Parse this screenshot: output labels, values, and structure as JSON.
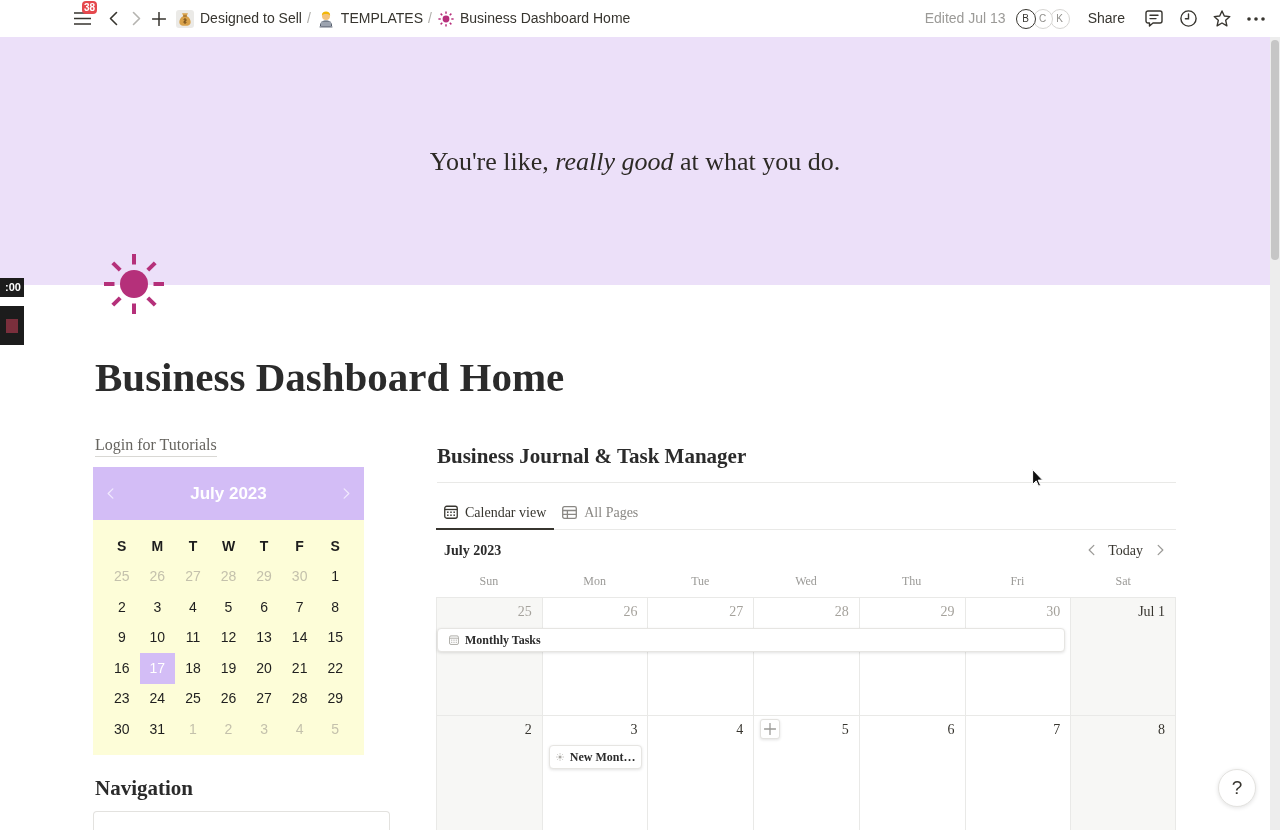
{
  "topbar": {
    "notification_count": "38",
    "nav_buttons": [
      {
        "kind": "back",
        "disabled": false
      },
      {
        "kind": "forward",
        "disabled": true
      },
      {
        "kind": "new",
        "disabled": false
      }
    ],
    "breadcrumbs": [
      {
        "label": "Designed to Sell",
        "separator": "/"
      },
      {
        "label": "TEMPLATES",
        "separator": "/"
      },
      {
        "label": "Business Dashboard Home"
      }
    ],
    "edited": "Edited Jul 13",
    "avatars": [
      {
        "initial": "B",
        "active": true
      },
      {
        "initial": "C",
        "active": false
      },
      {
        "initial": "K",
        "active": false
      }
    ],
    "share": "Share"
  },
  "recorder": {
    "timer": ":00"
  },
  "cover": {
    "quote": "You're like, *really good* at what you do."
  },
  "page": {
    "title": "Business Dashboard Home"
  },
  "sidebar": {
    "link": "Login for Tutorials",
    "mini_calendar": {
      "month": "July 2023",
      "weekdays": [
        "S",
        "M",
        "T",
        "W",
        "T",
        "F",
        "S"
      ],
      "weeks": [
        {
          "days": [
            {
              "day": "25",
              "muted": true,
              "selected": false
            },
            {
              "day": "26",
              "muted": true,
              "selected": false
            },
            {
              "day": "27",
              "muted": true,
              "selected": false
            },
            {
              "day": "28",
              "muted": true,
              "selected": false
            },
            {
              "day": "29",
              "muted": true,
              "selected": false
            },
            {
              "day": "30",
              "muted": true,
              "selected": false
            },
            {
              "day": "1",
              "muted": false,
              "selected": false
            }
          ]
        },
        {
          "days": [
            {
              "day": "2",
              "muted": false,
              "selected": false
            },
            {
              "day": "3",
              "muted": false,
              "selected": false
            },
            {
              "day": "4",
              "muted": false,
              "selected": false
            },
            {
              "day": "5",
              "muted": false,
              "selected": false
            },
            {
              "day": "6",
              "muted": false,
              "selected": false
            },
            {
              "day": "7",
              "muted": false,
              "selected": false
            },
            {
              "day": "8",
              "muted": false,
              "selected": false
            }
          ]
        },
        {
          "days": [
            {
              "day": "9",
              "muted": false,
              "selected": false
            },
            {
              "day": "10",
              "muted": false,
              "selected": false
            },
            {
              "day": "11",
              "muted": false,
              "selected": false
            },
            {
              "day": "12",
              "muted": false,
              "selected": false
            },
            {
              "day": "13",
              "muted": false,
              "selected": false
            },
            {
              "day": "14",
              "muted": false,
              "selected": false
            },
            {
              "day": "15",
              "muted": false,
              "selected": false
            }
          ]
        },
        {
          "days": [
            {
              "day": "16",
              "muted": false,
              "selected": false
            },
            {
              "day": "17",
              "muted": false,
              "selected": true
            },
            {
              "day": "18",
              "muted": false,
              "selected": false
            },
            {
              "day": "19",
              "muted": false,
              "selected": false
            },
            {
              "day": "20",
              "muted": false,
              "selected": false
            },
            {
              "day": "21",
              "muted": false,
              "selected": false
            },
            {
              "day": "22",
              "muted": false,
              "selected": false
            }
          ]
        },
        {
          "days": [
            {
              "day": "23",
              "muted": false,
              "selected": false
            },
            {
              "day": "24",
              "muted": false,
              "selected": false
            },
            {
              "day": "25",
              "muted": false,
              "selected": false
            },
            {
              "day": "26",
              "muted": false,
              "selected": false
            },
            {
              "day": "27",
              "muted": false,
              "selected": false
            },
            {
              "day": "28",
              "muted": false,
              "selected": false
            },
            {
              "day": "29",
              "muted": false,
              "selected": false
            }
          ]
        },
        {
          "days": [
            {
              "day": "30",
              "muted": false,
              "selected": false
            },
            {
              "day": "31",
              "muted": false,
              "selected": false
            },
            {
              "day": "1",
              "muted": true,
              "selected": false
            },
            {
              "day": "2",
              "muted": true,
              "selected": false
            },
            {
              "day": "3",
              "muted": true,
              "selected": false
            },
            {
              "day": "4",
              "muted": true,
              "selected": false
            },
            {
              "day": "5",
              "muted": true,
              "selected": false
            }
          ]
        }
      ]
    },
    "navigation": {
      "title": "Navigation"
    }
  },
  "database": {
    "title": "Business Journal & Task Manager",
    "views": [
      {
        "label": "Calendar view",
        "selected": true
      },
      {
        "label": "All Pages",
        "selected": false
      }
    ],
    "month": "July 2023",
    "today": "Today",
    "weekdays": [
      "Sun",
      "Mon",
      "Tue",
      "Wed",
      "Thu",
      "Fri",
      "Sat"
    ],
    "weeks": [
      {
        "bar": {
          "label": "Monthly Tasks"
        },
        "days": [
          {
            "label": "25",
            "muted": true,
            "hovered": false
          },
          {
            "label": "26",
            "muted": true,
            "hovered": false
          },
          {
            "label": "27",
            "muted": true,
            "hovered": false
          },
          {
            "label": "28",
            "muted": true,
            "hovered": false
          },
          {
            "label": "29",
            "muted": true,
            "hovered": false
          },
          {
            "label": "30",
            "muted": true,
            "hovered": false
          },
          {
            "label": "Jul 1",
            "muted": false,
            "hovered": false
          }
        ]
      },
      {
        "days": [
          {
            "label": "2",
            "muted": false,
            "hovered": false
          },
          {
            "label": "3",
            "muted": false,
            "hovered": false,
            "events": [
              {
                "label": "New Mont…"
              }
            ]
          },
          {
            "label": "4",
            "muted": false,
            "hovered": false
          },
          {
            "label": "5",
            "muted": false,
            "hovered": true
          },
          {
            "label": "6",
            "muted": false,
            "hovered": false
          },
          {
            "label": "7",
            "muted": false,
            "hovered": false
          },
          {
            "label": "8",
            "muted": false,
            "hovered": false
          }
        ]
      }
    ]
  },
  "help": {
    "label": "?"
  }
}
